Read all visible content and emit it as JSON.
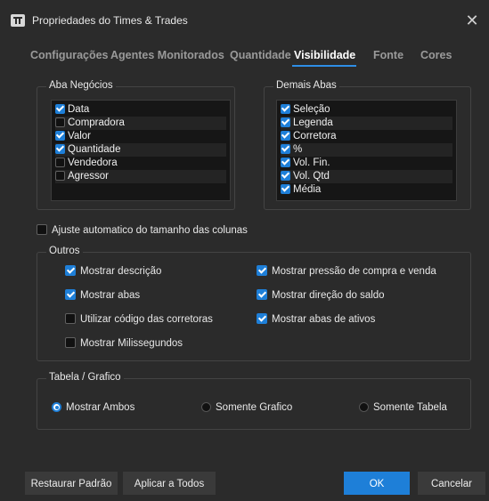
{
  "window": {
    "title": "Propriedades do Times & Trades"
  },
  "tabs": [
    {
      "label": "Configurações"
    },
    {
      "label": "Agentes Monitorados"
    },
    {
      "label": "Quantidade"
    },
    {
      "label": "Visibilidade"
    },
    {
      "label": "Fonte"
    },
    {
      "label": "Cores"
    }
  ],
  "active_tab": "Visibilidade",
  "aba_negocios": {
    "title": "Aba Negócios",
    "items": [
      {
        "label": "Data",
        "checked": true
      },
      {
        "label": "Compradora",
        "checked": false
      },
      {
        "label": "Valor",
        "checked": true
      },
      {
        "label": "Quantidade",
        "checked": true
      },
      {
        "label": "Vendedora",
        "checked": false
      },
      {
        "label": "Agressor",
        "checked": false
      }
    ]
  },
  "demais_abas": {
    "title": "Demais Abas",
    "items": [
      {
        "label": "Seleção",
        "checked": true
      },
      {
        "label": "Legenda",
        "checked": true
      },
      {
        "label": "Corretora",
        "checked": true
      },
      {
        "label": "%",
        "checked": true
      },
      {
        "label": "Vol. Fin.",
        "checked": true
      },
      {
        "label": "Vol. Qtd",
        "checked": true
      },
      {
        "label": "Média",
        "checked": true
      }
    ]
  },
  "auto_adjust": {
    "label": "Ajuste automatico do tamanho das colunas",
    "checked": false
  },
  "outros": {
    "title": "Outros",
    "options": [
      {
        "label": "Mostrar descrição",
        "checked": true
      },
      {
        "label": "Mostrar abas",
        "checked": true
      },
      {
        "label": "Utilizar código das corretoras",
        "checked": false
      },
      {
        "label": "Mostrar Milissegundos",
        "checked": false
      },
      {
        "label": "Mostrar pressão de compra e venda",
        "checked": true
      },
      {
        "label": "Mostrar direção do saldo",
        "checked": true
      },
      {
        "label": "Mostrar abas de ativos",
        "checked": true
      }
    ]
  },
  "tabela_grafico": {
    "title": "Tabela / Grafico",
    "options": [
      {
        "label": "Mostrar Ambos",
        "selected": true
      },
      {
        "label": "Somente Grafico",
        "selected": false
      },
      {
        "label": "Somente Tabela",
        "selected": false
      }
    ]
  },
  "buttons": {
    "restore": "Restaurar Padrão",
    "apply_all": "Aplicar a Todos",
    "ok": "OK",
    "cancel": "Cancelar"
  },
  "colors": {
    "accent": "#1e7fd8",
    "background": "#2b2b2b",
    "list_bg": "#161616"
  }
}
